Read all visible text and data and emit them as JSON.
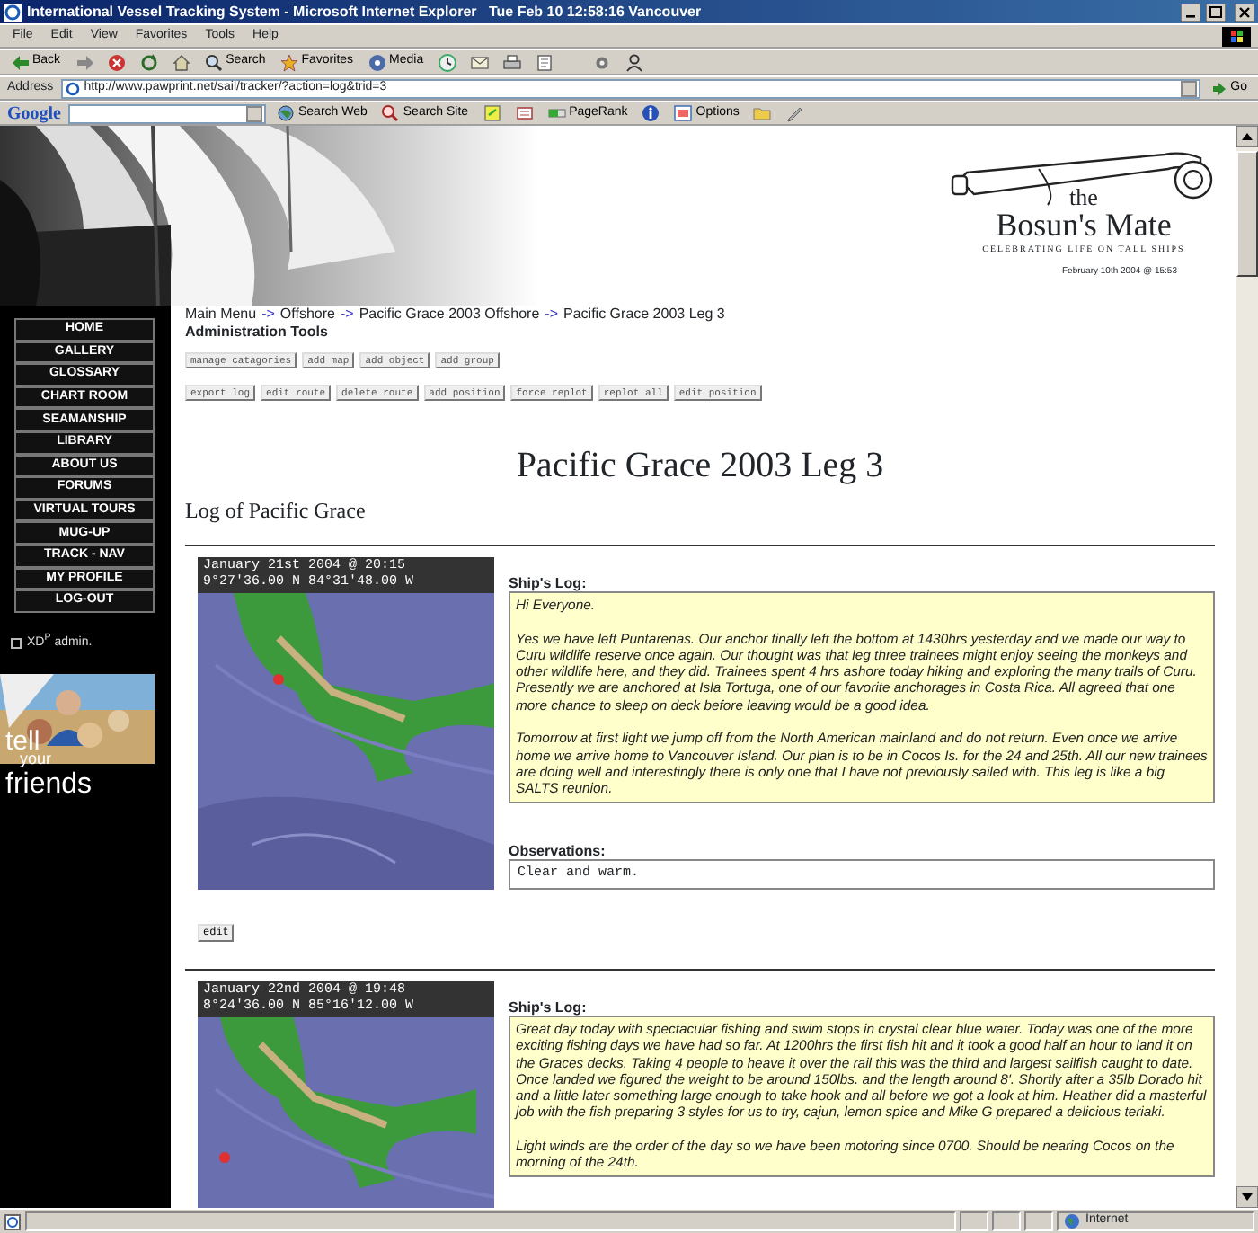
{
  "window": {
    "title": "International Vessel Tracking System - Microsoft Internet Explorer   Tue Feb 10 12:58:16 Vancouver"
  },
  "menu": [
    "File",
    "Edit",
    "View",
    "Favorites",
    "Tools",
    "Help"
  ],
  "toolbar": [
    {
      "kind": "back",
      "label": "Back"
    },
    {
      "kind": "forward"
    },
    {
      "kind": "stop"
    },
    {
      "kind": "refresh"
    },
    {
      "kind": "home"
    },
    {
      "kind": "search",
      "label": "Search"
    },
    {
      "kind": "favorites",
      "label": "Favorites"
    },
    {
      "kind": "media",
      "label": "Media"
    },
    {
      "kind": "history"
    },
    {
      "kind": "mail"
    },
    {
      "kind": "print"
    },
    {
      "kind": "edit"
    },
    {
      "kind": "discuss"
    },
    {
      "kind": "messenger"
    }
  ],
  "address": {
    "label": "Address",
    "value": "http://www.pawprint.net/sail/tracker/?action=log&trid=3",
    "go": "Go"
  },
  "google_bar": {
    "logo": "Google",
    "items": [
      {
        "kind": "search-web",
        "label": "Search Web"
      },
      {
        "kind": "search-site",
        "label": "Search Site"
      },
      {
        "kind": "highlight"
      },
      {
        "kind": "news"
      },
      {
        "kind": "pagerank",
        "label": "PageRank"
      },
      {
        "kind": "info"
      },
      {
        "kind": "options",
        "label": "Options"
      },
      {
        "kind": "folder"
      },
      {
        "kind": "pencil"
      }
    ]
  },
  "sidebar": {
    "nav": [
      "HOME",
      "GALLERY",
      "GLOSSARY",
      "CHART ROOM",
      "SEAMANSHIP",
      "LIBRARY",
      "ABOUT US",
      "FORUMS",
      "VIRTUAL TOURS",
      "MUG-UP",
      "TRACK - NAV",
      "MY PROFILE",
      "LOG-OUT"
    ],
    "admin": {
      "label": "XD$^{P}$ admin.",
      "checked": false
    },
    "promo": [
      "tell",
      "your",
      "friends"
    ]
  },
  "logo": {
    "line1": "the",
    "line2": "Bosun's Mate",
    "tagline": "CELEBRATING LIFE ON TALL SHIPS",
    "date": "February 10th 2004 @ 15:53"
  },
  "breadcrumb": {
    "items": [
      "Main Menu",
      "Offshore",
      "Pacific Grace 2003 Offshore",
      "Pacific Grace 2003 Leg 3"
    ],
    "separator": "->"
  },
  "admin_tools": {
    "title": "Administration Tools",
    "rows": [
      [
        "manage catagories",
        "add map",
        "add object",
        "add group"
      ],
      [
        "export log",
        "edit route",
        "delete route",
        "add position",
        "force replot",
        "replot all",
        "edit position"
      ]
    ]
  },
  "page_title": "Pacific Grace 2003 Leg 3",
  "subtitle": "Log of Pacific Grace",
  "entries": [
    {
      "date": "January 21st 2004 @ 20:15",
      "position": "9°27'36.00 N 84°31'48.00 W",
      "log_label": "Ship's Log:",
      "log": [
        "Hi Everyone.",
        "Yes we have left Puntarenas. Our anchor finally left the bottom at 1430hrs yesterday and we made our way to Curu wildlife reserve once again. Our thought was that leg three trainees might enjoy seeing the monkeys and other wildlife here, and they did. Trainees spent 4 hrs ashore today hiking and exploring the many trails of Curu. Presently we are anchored at Isla Tortuga, one of our favorite anchorages in Costa Rica. All agreed that one more chance to sleep on deck before leaving would be a good idea.",
        "Tomorrow at first light we jump off from the North American mainland and do not return. Even once we arrive home we arrive home to Vancouver Island. Our plan is to be in Cocos Is. for the 24 and 25th. All our new trainees are doing well and interestingly there is only one that I have not previously sailed with. This leg is like a big SALTS reunion."
      ],
      "observations_label": "Observations:",
      "observations": "Clear and warm.",
      "edit": "edit"
    },
    {
      "date": "January 22nd 2004 @ 19:48",
      "position": "8°24'36.00 N 85°16'12.00 W",
      "log_label": "Ship's Log:",
      "log": [
        "Great day today with spectacular fishing and swim stops in crystal clear blue water. Today was one of the more exciting fishing days we have had so far. At 1200hrs the first fish hit and it took a good half an hour to land it on the Graces decks. Taking 4 people to heave it over the rail this was the third and largest sailfish caught to date. Once landed we figured the weight to be around 150lbs. and the length around 8'. Shortly after a 35lb Dorado hit and a little later something large enough to take hook and all before we got a look at him. Heather did a masterful job with the fish preparing 3 styles for us to try, cajun, lemon spice and Mike G prepared a delicious teriaki.",
        "Light winds are the order of the day so we have been motoring since 0700. Should be nearing Cocos on the morning of the 24th."
      ]
    }
  ],
  "status_bar": {
    "zone": "Internet"
  }
}
